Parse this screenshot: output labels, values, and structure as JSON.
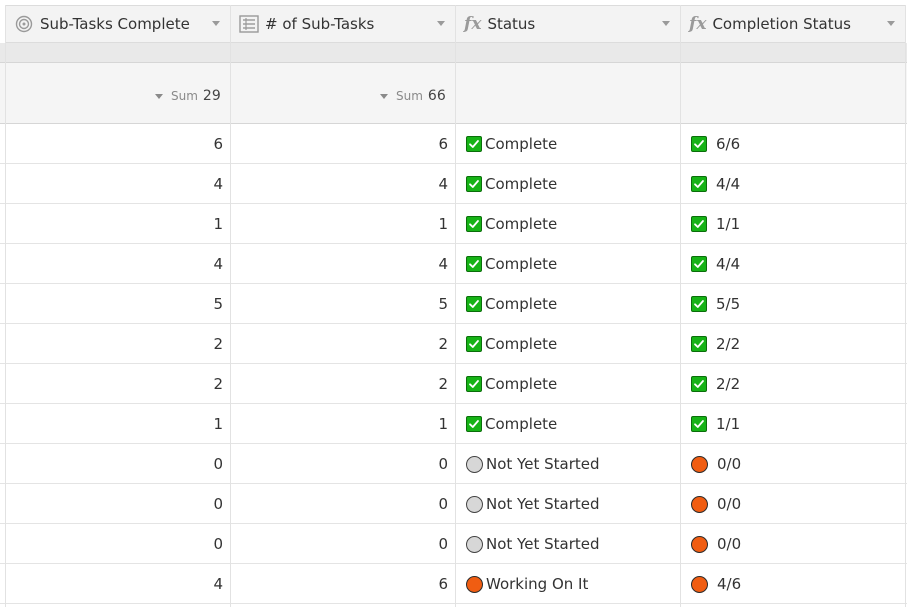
{
  "columns": [
    {
      "label": "Sub-Tasks Complete",
      "icon": "rollup-icon"
    },
    {
      "label": "# of Sub-Tasks",
      "icon": "count-icon"
    },
    {
      "label": "Status",
      "icon": "formula-icon"
    },
    {
      "label": "Completion Status",
      "icon": "formula-icon"
    }
  ],
  "summary": {
    "sub_tasks_complete": {
      "label": "Sum",
      "value": "29"
    },
    "num_sub_tasks": {
      "label": "Sum",
      "value": "66"
    }
  },
  "rows": [
    {
      "complete": "6",
      "total": "6",
      "status": "Complete",
      "status_icon": "check",
      "completion": "6/6",
      "completion_icon": "check"
    },
    {
      "complete": "4",
      "total": "4",
      "status": "Complete",
      "status_icon": "check",
      "completion": "4/4",
      "completion_icon": "check"
    },
    {
      "complete": "1",
      "total": "1",
      "status": "Complete",
      "status_icon": "check",
      "completion": "1/1",
      "completion_icon": "check"
    },
    {
      "complete": "4",
      "total": "4",
      "status": "Complete",
      "status_icon": "check",
      "completion": "4/4",
      "completion_icon": "check"
    },
    {
      "complete": "5",
      "total": "5",
      "status": "Complete",
      "status_icon": "check",
      "completion": "5/5",
      "completion_icon": "check"
    },
    {
      "complete": "2",
      "total": "2",
      "status": "Complete",
      "status_icon": "check",
      "completion": "2/2",
      "completion_icon": "check"
    },
    {
      "complete": "2",
      "total": "2",
      "status": "Complete",
      "status_icon": "check",
      "completion": "2/2",
      "completion_icon": "check"
    },
    {
      "complete": "1",
      "total": "1",
      "status": "Complete",
      "status_icon": "check",
      "completion": "1/1",
      "completion_icon": "check"
    },
    {
      "complete": "0",
      "total": "0",
      "status": "Not Yet Started",
      "status_icon": "grey-circle",
      "completion": "0/0",
      "completion_icon": "orange-circle"
    },
    {
      "complete": "0",
      "total": "0",
      "status": "Not Yet Started",
      "status_icon": "grey-circle",
      "completion": "0/0",
      "completion_icon": "orange-circle"
    },
    {
      "complete": "0",
      "total": "0",
      "status": "Not Yet Started",
      "status_icon": "grey-circle",
      "completion": "0/0",
      "completion_icon": "orange-circle"
    },
    {
      "complete": "4",
      "total": "6",
      "status": "Working On It",
      "status_icon": "orange-circle",
      "completion": "4/6",
      "completion_icon": "orange-circle"
    }
  ],
  "colors": {
    "check_green": "#16b316",
    "not_started_grey": "#d7d7d7",
    "working_orange": "#f05d12"
  }
}
